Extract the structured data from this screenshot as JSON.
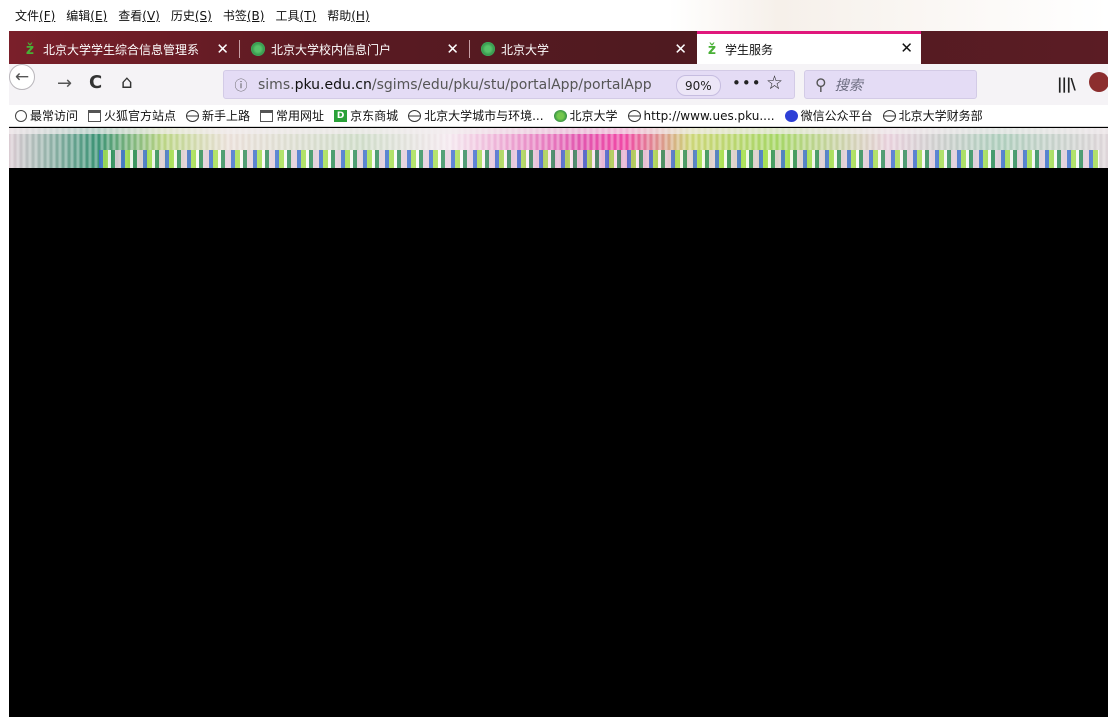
{
  "menubar": {
    "items": [
      {
        "label": "文件",
        "key": "(F)"
      },
      {
        "label": "编辑",
        "key": "(E)"
      },
      {
        "label": "查看",
        "key": "(V)"
      },
      {
        "label": "历史",
        "key": "(S)"
      },
      {
        "label": "书签",
        "key": "(B)"
      },
      {
        "label": "工具",
        "key": "(T)"
      },
      {
        "label": "帮助",
        "key": "(H)"
      }
    ]
  },
  "tabs": [
    {
      "title": "北京大学学生综合信息管理系",
      "icon": "green-logo-icon",
      "close": "✕"
    },
    {
      "title": "北京大学校内信息门户",
      "icon": "pku-seal-icon",
      "close": "✕"
    },
    {
      "title": "北京大学",
      "icon": "pku-seal-icon",
      "close": "✕"
    },
    {
      "title": "学生服务",
      "icon": "green-logo-icon",
      "close": "✕",
      "active": true
    }
  ],
  "navbar": {
    "url_prefix": "sims.",
    "url_domain": "pku.edu.cn",
    "url_path": "/sgims/edu/pku/stu/portalApp/portalApp",
    "zoom": "90%",
    "more": "•••",
    "search_placeholder": "搜索"
  },
  "bookmarks": [
    {
      "label": "最常访问",
      "icon": "gear-icon"
    },
    {
      "label": "火狐官方站点",
      "icon": "folder-icon"
    },
    {
      "label": "新手上路",
      "icon": "globe-icon"
    },
    {
      "label": "常用网址",
      "icon": "folder-icon"
    },
    {
      "label": "京东商城",
      "icon": "jd-icon"
    },
    {
      "label": "北京大学城市与环境...",
      "icon": "globe-icon"
    },
    {
      "label": "北京大学",
      "icon": "pku-seal-icon"
    },
    {
      "label": "http://www.ues.pku....",
      "icon": "globe-icon"
    },
    {
      "label": "微信公众平台",
      "icon": "wechat-icon"
    },
    {
      "label": "北京大学财务部",
      "icon": "globe-icon"
    }
  ],
  "colors": {
    "tab_strip": "#5a1a22",
    "active_tab_accent": "#e0177c",
    "url_bar_bg": "#e4dcf5",
    "content_bg": "#000000"
  }
}
